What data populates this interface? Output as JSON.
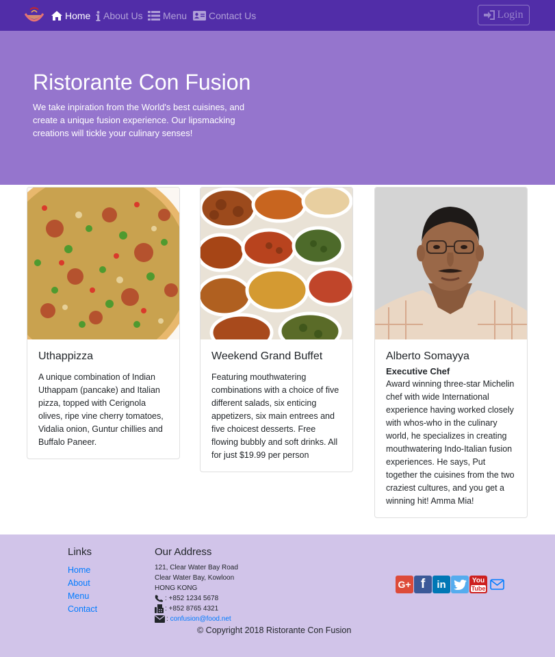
{
  "nav": {
    "items": [
      {
        "label": "Home",
        "icon": "home-icon"
      },
      {
        "label": "About Us",
        "icon": "info-icon"
      },
      {
        "label": "Menu",
        "icon": "list-icon"
      },
      {
        "label": "Contact Us",
        "icon": "address-card-icon"
      }
    ],
    "login_label": "Login"
  },
  "jumbotron": {
    "title": "Ristorante Con Fusion",
    "text": "We take inpiration from the World's best cuisines, and create a unique fusion experience. Our lipsmacking creations will tickle your culinary senses!"
  },
  "cards": [
    {
      "title": "Uthappizza",
      "subtitle": "",
      "text": "A unique combination of Indian Uthappam (pancake) and Italian pizza, topped with Cerignola olives, ripe vine cherry tomatoes, Vidalia onion, Guntur chillies and Buffalo Paneer."
    },
    {
      "title": "Weekend Grand Buffet",
      "subtitle": "",
      "text": "Featuring mouthwatering combinations with a choice of five different salads, six enticing appetizers, six main entrees and five choicest desserts. Free flowing bubbly and soft drinks. All for just $19.99 per person"
    },
    {
      "title": "Alberto Somayya",
      "subtitle": "Executive Chef",
      "text": "Award winning three-star Michelin chef with wide International experience having worked closely with whos-who in the culinary world, he specializes in creating mouthwatering Indo-Italian fusion experiences. He says, Put together the cuisines from the two craziest cultures, and you get a winning hit! Amma Mia!"
    }
  ],
  "footer": {
    "links_heading": "Links",
    "links": [
      "Home",
      "About",
      "Menu",
      "Contact"
    ],
    "address_heading": "Our Address",
    "address_lines": [
      "121, Clear Water Bay Road",
      "Clear Water Bay, Kowloon",
      "HONG KONG"
    ],
    "phone": ": +852 1234 5678",
    "fax": ": +852 8765 4321",
    "email_prefix": ": ",
    "email": "confusion@food.net",
    "copyright": "© Copyright 2018 Ristorante Con Fusion",
    "socials": [
      {
        "name": "google-plus",
        "glyph": "G+",
        "color": "#dd4b39"
      },
      {
        "name": "facebook",
        "glyph": "f",
        "color": "#3b5998"
      },
      {
        "name": "linkedin",
        "glyph": "in",
        "color": "#0077b5"
      },
      {
        "name": "twitter",
        "glyph": "",
        "color": "#55acee"
      },
      {
        "name": "youtube",
        "glyph": "You",
        "color": "#cd201f"
      }
    ]
  },
  "colors": {
    "navbar": "#512da8",
    "jumbotron": "#9575cd",
    "footer": "#d1c4e9",
    "link": "#007bff"
  }
}
